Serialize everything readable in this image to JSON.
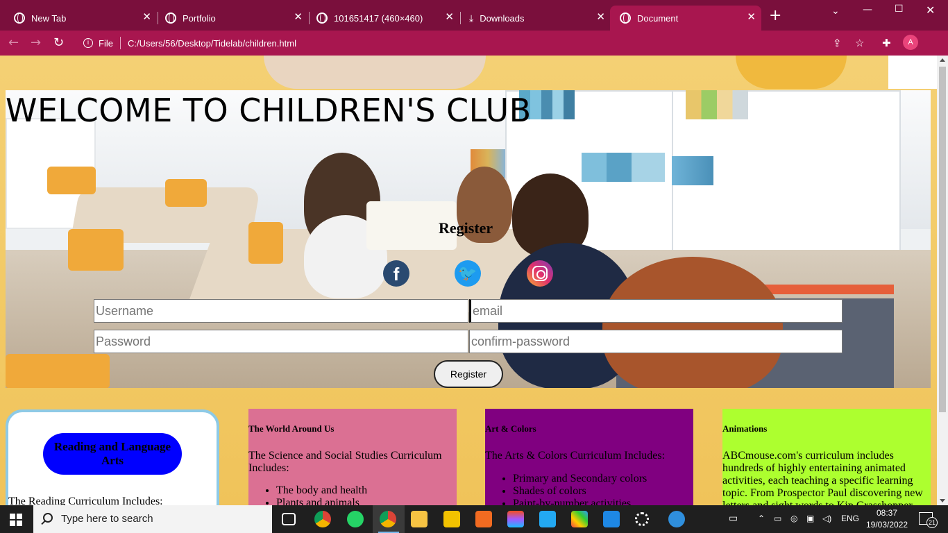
{
  "browser": {
    "tabs": [
      {
        "label": "New Tab",
        "icon": "chrome-icon"
      },
      {
        "label": "Portfolio",
        "icon": "globe-icon"
      },
      {
        "label": "101651417 (460×460)",
        "icon": "globe-icon"
      },
      {
        "label": "Downloads",
        "icon": "download-icon"
      },
      {
        "label": "Document",
        "icon": "globe-icon",
        "active": true
      }
    ],
    "close_glyph": "✕",
    "new_tab_glyph": "+",
    "address": {
      "scheme_label": "File",
      "url": "C:/Users/56/Desktop/Tidelab/children.html"
    },
    "profile_initial": "A",
    "theme_color": "#a8164f"
  },
  "page": {
    "title": "WELCOME TO CHILDREN'S CLUB",
    "register_heading": "Register",
    "social": {
      "facebook": "f",
      "twitter": "🐦",
      "instagram": ""
    },
    "form": {
      "username_placeholder": "Username",
      "email_placeholder": "email",
      "password_placeholder": "Password",
      "confirm_placeholder": "confirm-password",
      "submit_label": "Register"
    },
    "cards": {
      "reading": {
        "title": "Reading and Language Arts",
        "body": "The Reading Curriculum Includes:",
        "pill_color": "#0000ff"
      },
      "world": {
        "heading": "The World Around Us",
        "intro": "The Science and Social Studies Curriculum Includes:",
        "items": [
          "The body and health",
          "Plants and animals"
        ],
        "color": "#db7093"
      },
      "art": {
        "heading": "Art & Colors",
        "intro": "The Arts & Colors Curriculum Includes:",
        "items": [
          "Primary and Secondary colors",
          "Shades of colors",
          "Paint-by-number activities"
        ],
        "color": "#800080"
      },
      "anim": {
        "heading": "Animations",
        "intro": "ABCmouse.com's curriculum includes hundreds of highly entertaining animated activities, each teaching a specific learning topic. From Prospector Paul discovering new letters and sight words to Kip Grasshopper",
        "color": "#adff2f"
      }
    }
  },
  "taskbar": {
    "search_placeholder": "Type here to search",
    "language": "ENG",
    "time": "08:37",
    "date": "19/03/2022",
    "notifications": "21"
  }
}
